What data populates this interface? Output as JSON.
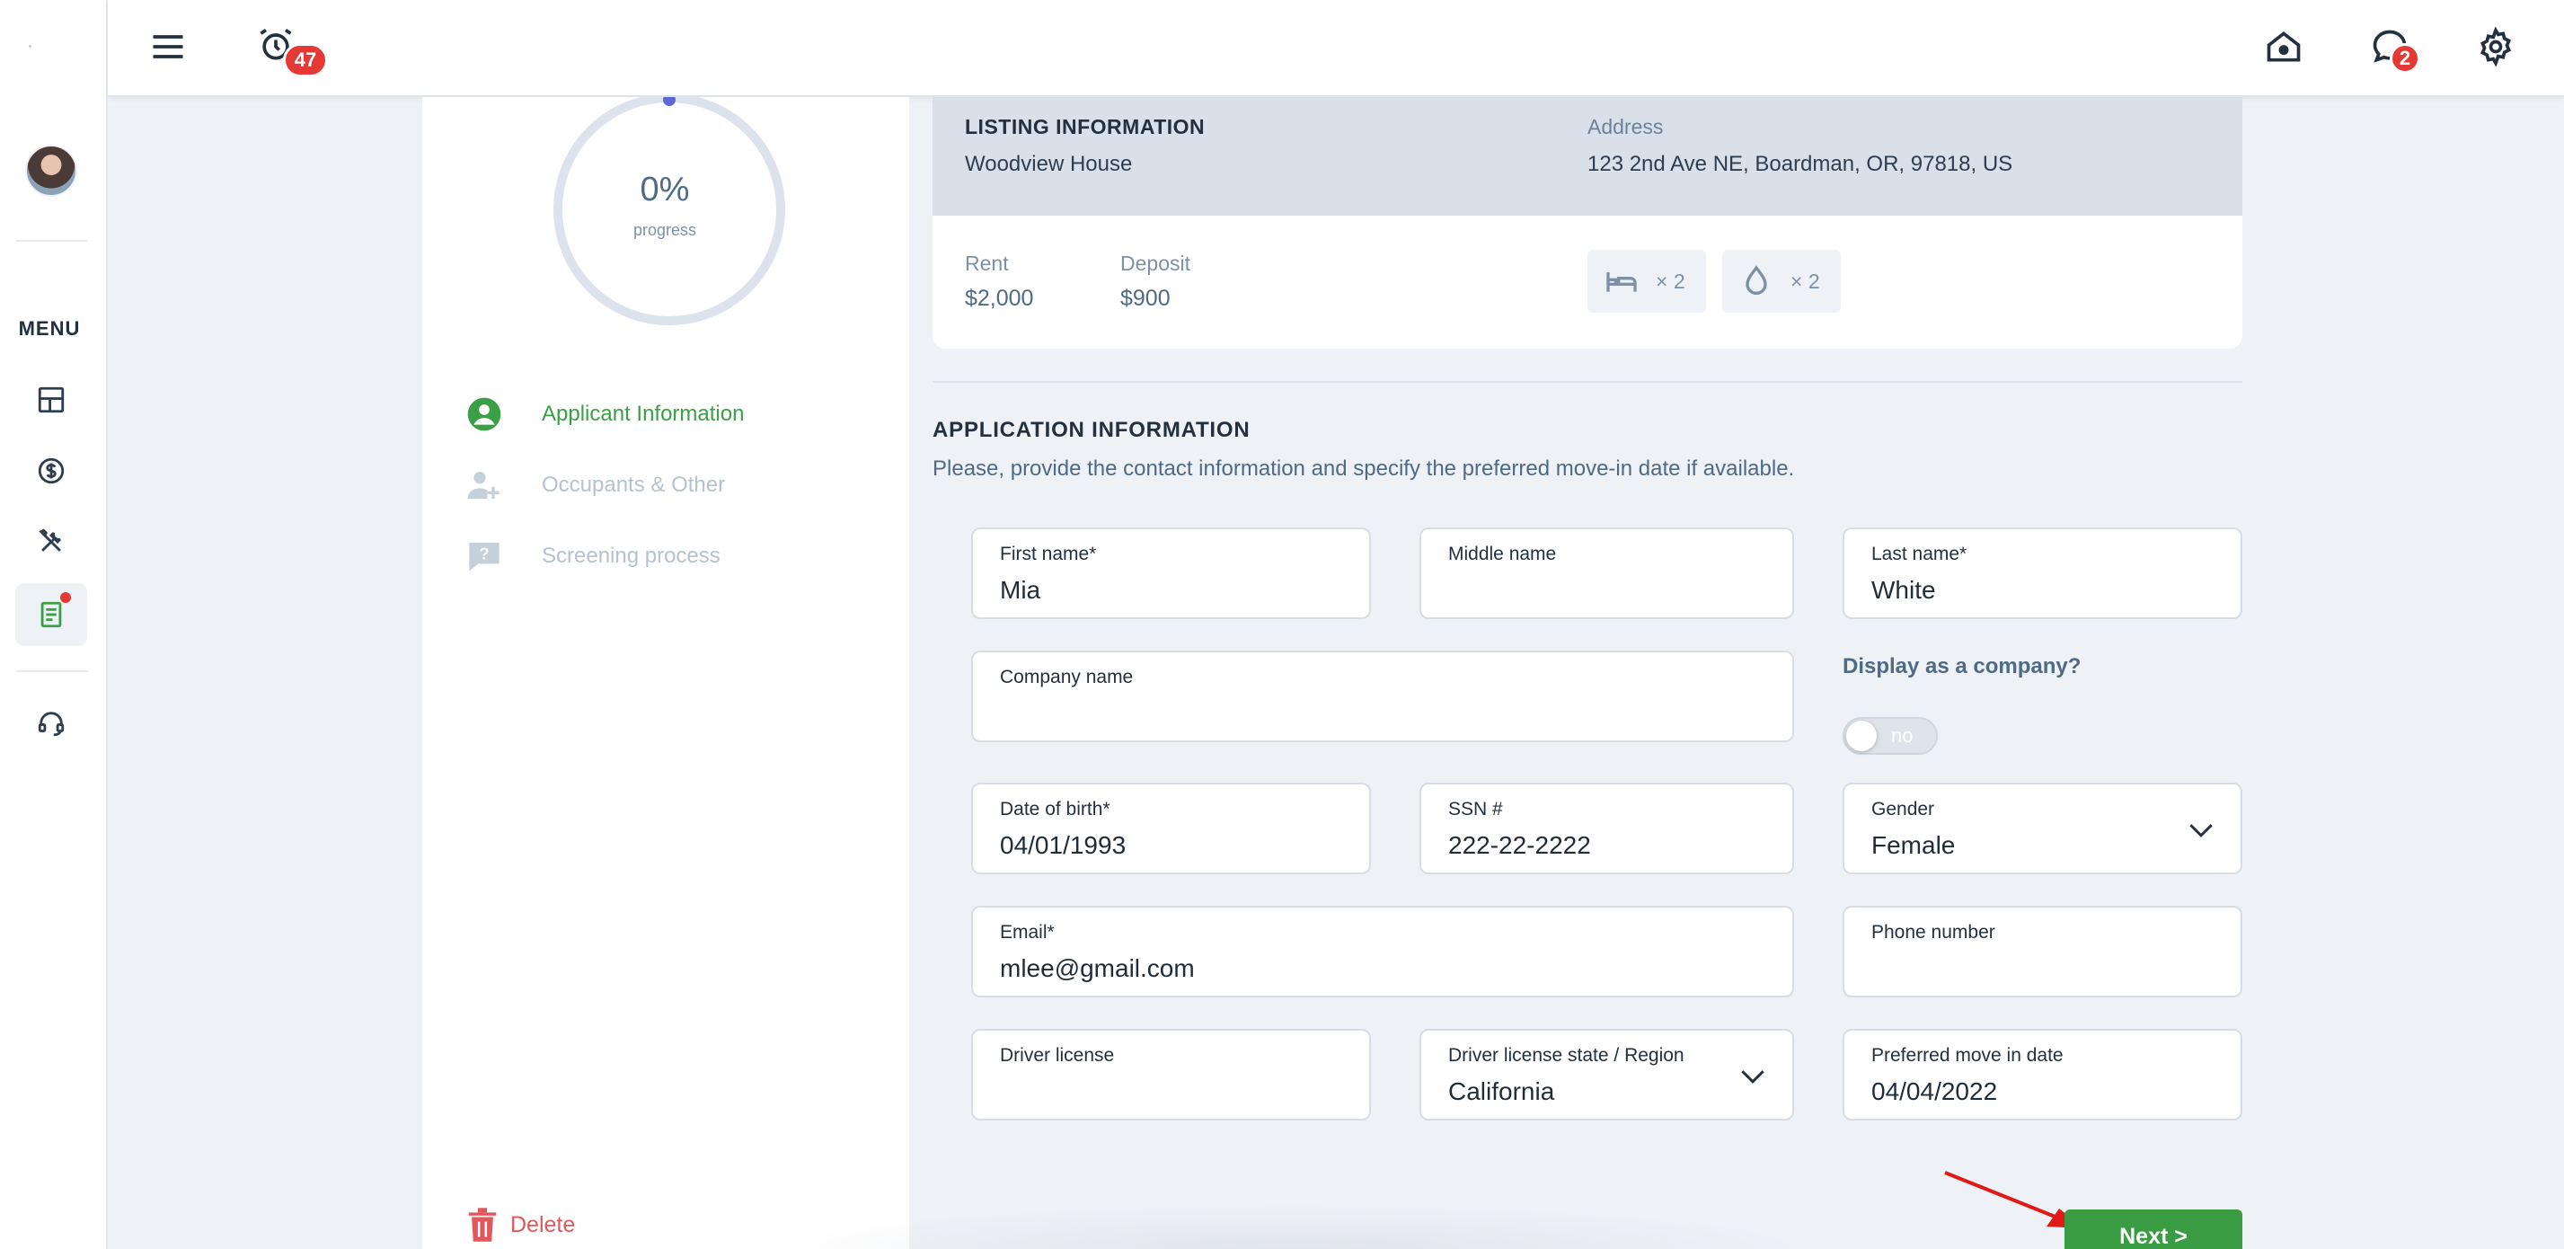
{
  "topbar": {
    "notifications_count": "47",
    "messages_count": "2"
  },
  "sidebar": {
    "menu_label": "MENU",
    "items": [
      "dashboard",
      "payments",
      "maintenance",
      "applications",
      "support"
    ]
  },
  "progress": {
    "percent": "0%",
    "label": "progress",
    "value": 0
  },
  "steps": [
    {
      "label": "Applicant Information",
      "state": "active"
    },
    {
      "label": "Occupants & Other",
      "state": "inactive"
    },
    {
      "label": "Screening process",
      "state": "inactive"
    }
  ],
  "delete_label": "Delete",
  "listing": {
    "title": "LISTING INFORMATION",
    "name": "Woodview House",
    "address_label": "Address",
    "address": "123 2nd Ave NE, Boardman, OR, 97818, US",
    "rent_label": "Rent",
    "rent": "$2,000",
    "deposit_label": "Deposit",
    "deposit": "$900",
    "beds": "× 2",
    "baths": "× 2"
  },
  "application": {
    "title": "APPLICATION INFORMATION",
    "description": "Please, provide the contact information and specify the preferred move-in date if available."
  },
  "fields": {
    "first_name": {
      "label": "First name*",
      "value": "Mia"
    },
    "middle_name": {
      "label": "Middle name",
      "value": ""
    },
    "last_name": {
      "label": "Last name*",
      "value": "White"
    },
    "company_name": {
      "label": "Company name",
      "value": ""
    },
    "display_company": {
      "label": "Display as a company?",
      "toggle": "no"
    },
    "dob": {
      "label": "Date of birth*",
      "value": "04/01/1993"
    },
    "ssn": {
      "label": "SSN #",
      "value": "222-22-2222"
    },
    "gender": {
      "label": "Gender",
      "value": "Female"
    },
    "email": {
      "label": "Email*",
      "value": "mlee@gmail.com"
    },
    "phone": {
      "label": "Phone number",
      "value": ""
    },
    "driver_license": {
      "label": "Driver license",
      "value": ""
    },
    "dl_state": {
      "label": "Driver license state / Region",
      "value": "California"
    },
    "move_in": {
      "label": "Preferred move in date",
      "value": "04/04/2022"
    }
  },
  "next_label": "Next >",
  "colors": {
    "accent_green": "#3a9c42",
    "badge_red": "#e53935",
    "primary_text": "#22303f",
    "muted_text": "#7d91a6"
  }
}
